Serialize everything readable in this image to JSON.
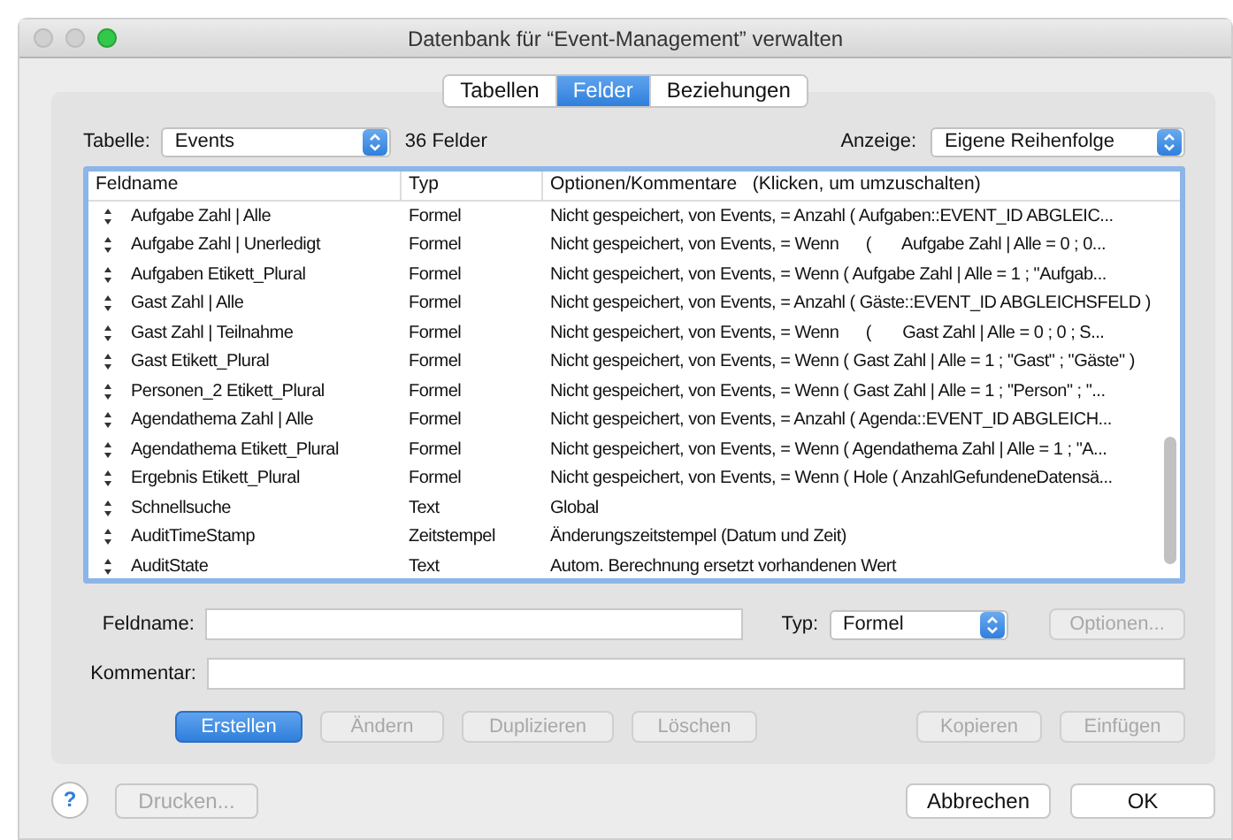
{
  "window": {
    "title": "Datenbank für “Event-Management” verwalten"
  },
  "tabs": [
    {
      "label": "Tabellen",
      "selected": false
    },
    {
      "label": "Felder",
      "selected": true
    },
    {
      "label": "Beziehungen",
      "selected": false
    }
  ],
  "table_selector": {
    "label": "Tabelle:",
    "value": "Events",
    "count": "36 Felder"
  },
  "view_selector": {
    "label": "Anzeige:",
    "value": "Eigene Reihenfolge"
  },
  "table": {
    "columns": [
      "Feldname",
      "Typ",
      "Optionen/Kommentare   (Klicken, um umzuschalten)"
    ],
    "rows": [
      {
        "name": "Aufgabe Zahl | Alle",
        "type": "Formel",
        "options": "Nicht gespeichert, von Events, = Anzahl ( Aufgaben::EVENT_ID ABGLEIC..."
      },
      {
        "name": "Aufgabe Zahl | Unerledigt",
        "type": "Formel",
        "options": "Nicht gespeichert, von Events, = Wenn      (       Aufgabe Zahl | Alle = 0 ; 0..."
      },
      {
        "name": "Aufgaben Etikett_Plural",
        "type": "Formel",
        "options": "Nicht gespeichert, von Events, = Wenn ( Aufgabe Zahl | Alle = 1 ; \"Aufgab..."
      },
      {
        "name": "Gast Zahl | Alle",
        "type": "Formel",
        "options": "Nicht gespeichert, von Events, = Anzahl ( Gäste::EVENT_ID ABGLEICHSFELD )"
      },
      {
        "name": "Gast Zahl | Teilnahme",
        "type": "Formel",
        "options": "Nicht gespeichert, von Events, = Wenn      (       Gast Zahl | Alle = 0 ; 0 ; S..."
      },
      {
        "name": "Gast Etikett_Plural",
        "type": "Formel",
        "options": "Nicht gespeichert, von Events, = Wenn ( Gast Zahl | Alle = 1 ; \"Gast\" ; \"Gäste\" )"
      },
      {
        "name": "Personen_2 Etikett_Plural",
        "type": "Formel",
        "options": "Nicht gespeichert, von Events, = Wenn ( Gast Zahl | Alle = 1 ; \"Person\" ; \"..."
      },
      {
        "name": "Agendathema Zahl | Alle",
        "type": "Formel",
        "options": "Nicht gespeichert, von Events, = Anzahl ( Agenda::EVENT_ID ABGLEICH..."
      },
      {
        "name": "Agendathema Etikett_Plural",
        "type": "Formel",
        "options": "Nicht gespeichert, von Events, = Wenn ( Agendathema Zahl | Alle = 1 ; \"A..."
      },
      {
        "name": "Ergebnis Etikett_Plural",
        "type": "Formel",
        "options": "Nicht gespeichert, von Events, = Wenn ( Hole ( AnzahlGefundeneDatensä..."
      },
      {
        "name": "Schnellsuche",
        "type": "Text",
        "options": "Global"
      },
      {
        "name": "AuditTimeStamp",
        "type": "Zeitstempel",
        "options": "Änderungszeitstempel (Datum und Zeit)"
      },
      {
        "name": "AuditState",
        "type": "Text",
        "options": "Autom. Berechnung ersetzt vorhandenen Wert"
      }
    ]
  },
  "field_name": {
    "label": "Feldname:"
  },
  "field_type": {
    "label": "Typ:",
    "value": "Formel"
  },
  "options_button": {
    "label": "Optionen...",
    "disabled": true
  },
  "comment": {
    "label": "Kommentar:"
  },
  "actions": [
    {
      "label": "Erstellen",
      "disabled": false,
      "default": true
    },
    {
      "label": "Ändern",
      "disabled": true,
      "default": false
    },
    {
      "label": "Duplizieren",
      "disabled": true,
      "default": false
    },
    {
      "label": "Löschen",
      "disabled": true,
      "default": false
    },
    {
      "label": "Kopieren",
      "disabled": true,
      "default": false
    },
    {
      "label": "Einfügen",
      "disabled": true,
      "default": false
    }
  ],
  "help_button": {
    "label": "?"
  },
  "print_button": {
    "label": "Drucken...",
    "disabled": true
  },
  "dialog_buttons": [
    {
      "label": "Abbrechen",
      "disabled": false
    },
    {
      "label": "OK",
      "disabled": false
    }
  ]
}
